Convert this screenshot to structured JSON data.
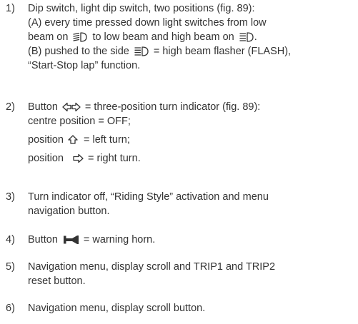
{
  "items": [
    {
      "number": "1)",
      "l1": "Dip switch, light dip switch, two positions (fig. 89):",
      "l2": "(A) every time pressed down light switches from low",
      "l3a": "beam on",
      "l3b": "to low beam and high beam on",
      "l3c": ".",
      "l4a": "(B) pushed to the side",
      "l4b": "= high beam flasher (FLASH),",
      "l5": "“Start-Stop lap” function."
    },
    {
      "number": "2)",
      "l1a": "Button",
      "l1b": "= three-position turn indicator (fig. 89):",
      "l2": "centre position = OFF;",
      "l3a": "position",
      "l3b": "= left turn;",
      "l4a": "position",
      "l4b": "= right turn."
    },
    {
      "number": "3)",
      "l1": "Turn indicator off, “Riding Style” activation and menu",
      "l2": "navigation button."
    },
    {
      "number": "4)",
      "l1a": "Button",
      "l1b": "= warning horn."
    },
    {
      "number": "5)",
      "l1": "Navigation menu, display scroll and TRIP1 and TRIP2",
      "l2": "reset button."
    },
    {
      "number": "6)",
      "l1": "Navigation menu, display scroll button."
    }
  ],
  "icons": {
    "low_beam": "low-beam-icon",
    "high_beam": "high-beam-icon",
    "turn_both": "turn-indicator-both-icon",
    "turn_left": "turn-left-icon",
    "turn_right": "turn-right-icon",
    "horn": "horn-icon"
  }
}
